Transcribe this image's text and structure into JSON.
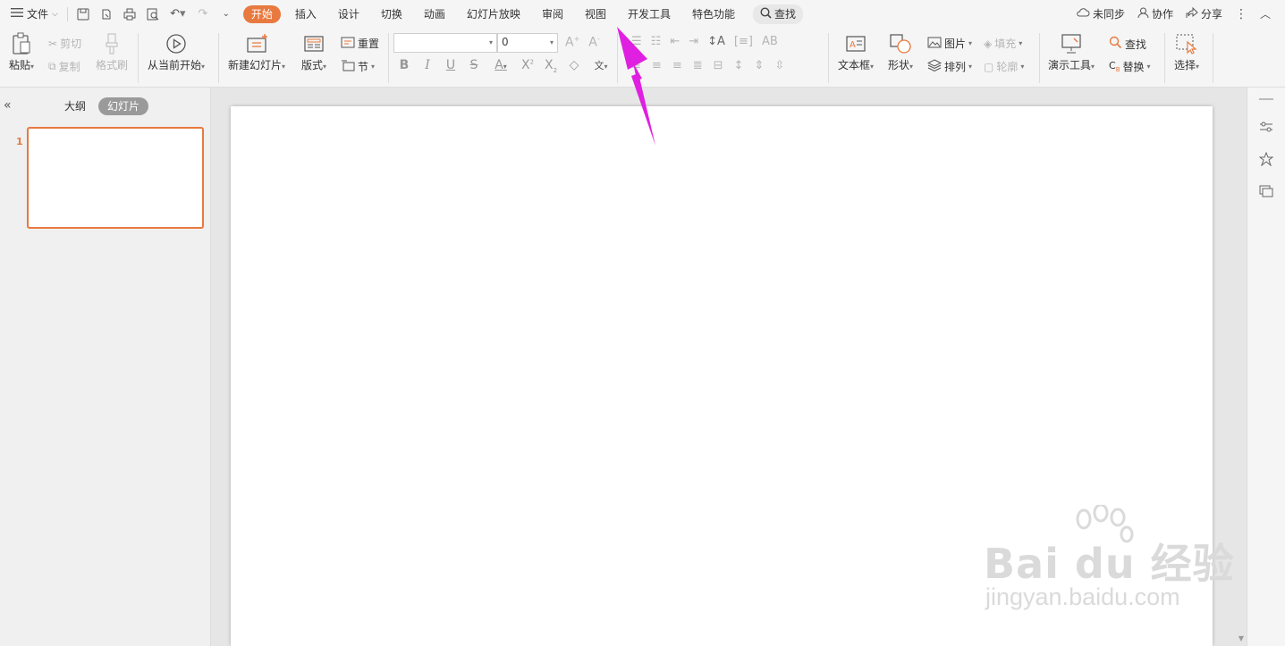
{
  "menubar": {
    "file_label": "文件",
    "tabs": [
      {
        "label": "开始",
        "active": true
      },
      {
        "label": "插入"
      },
      {
        "label": "设计"
      },
      {
        "label": "切换"
      },
      {
        "label": "动画"
      },
      {
        "label": "幻灯片放映"
      },
      {
        "label": "审阅"
      },
      {
        "label": "视图"
      },
      {
        "label": "开发工具"
      },
      {
        "label": "特色功能"
      }
    ],
    "search_label": "查找",
    "sync_label": "未同步",
    "collab_label": "协作",
    "share_label": "分享"
  },
  "ribbon": {
    "paste": "粘贴",
    "cut": "剪切",
    "copy": "复制",
    "format_painter": "格式刷",
    "play_from_current": "从当前开始",
    "new_slide": "新建幻灯片",
    "layout": "版式",
    "reset": "重置",
    "section": "节",
    "font_size_value": "0",
    "textbox": "文本框",
    "shape": "形状",
    "picture": "图片",
    "arrange": "排列",
    "fill": "填充",
    "outline": "轮廓",
    "present_tools": "演示工具",
    "find": "查找",
    "replace": "替换",
    "select": "选择"
  },
  "left_panel": {
    "outline_tab": "大纲",
    "slides_tab": "幻灯片",
    "slide_number": "1"
  },
  "watermark": {
    "main": "Bai du 经验",
    "sub": "jingyan.baidu.com"
  },
  "colors": {
    "accent": "#e8793f",
    "annotation_arrow": "#e020e0"
  }
}
